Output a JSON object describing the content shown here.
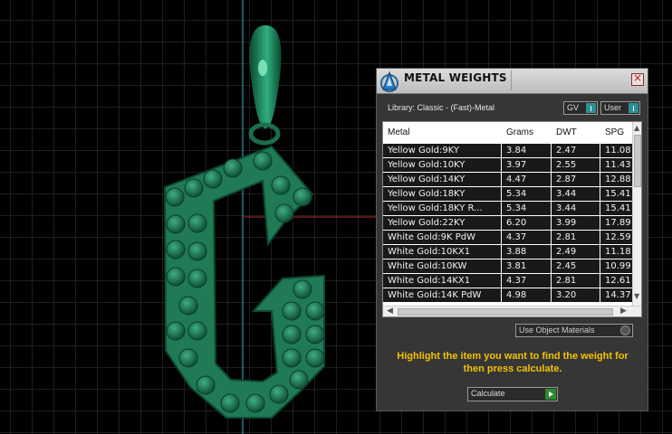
{
  "panel": {
    "title": "METAL WEIGHTS",
    "close_glyph": "×",
    "library_label": "Library: Classic - (Fast)-Metal",
    "toggles": {
      "gv": "GV",
      "user": "User"
    },
    "table": {
      "headers": [
        "Metal",
        "Grams",
        "DWT",
        "SPG"
      ],
      "rows": [
        [
          "Yellow Gold:9KY",
          "3.84",
          "2.47",
          "11.08"
        ],
        [
          "Yellow Gold:10KY",
          "3.97",
          "2.55",
          "11.43"
        ],
        [
          "Yellow Gold:14KY",
          "4.47",
          "2.87",
          "12.88"
        ],
        [
          "Yellow Gold:18KY",
          "5.34",
          "3.44",
          "15.41"
        ],
        [
          "Yellow Gold:18KY R...",
          "5.34",
          "3.44",
          "15.41"
        ],
        [
          "Yellow Gold:22KY",
          "6.20",
          "3.99",
          "17.89"
        ],
        [
          "White Gold:9K PdW",
          "4.37",
          "2.81",
          "12.59"
        ],
        [
          "White Gold:10KX1",
          "3.88",
          "2.49",
          "11.18"
        ],
        [
          "White Gold:10KW",
          "3.81",
          "2.45",
          "10.99"
        ],
        [
          "White Gold:14KX1",
          "4.37",
          "2.81",
          "12.61"
        ],
        [
          "White Gold:14K PdW",
          "4.98",
          "3.20",
          "14.37"
        ]
      ]
    },
    "use_object_materials": "Use Object Materials",
    "hint": "Highlight the item you want to find the weight for then press calculate.",
    "calculate_label": "Calculate"
  },
  "icons": {
    "app_logo": "matrix-logo-icon",
    "close": "close-icon",
    "scroll_up": "scroll-up-arrow-icon",
    "scroll_down": "scroll-down-arrow-icon",
    "scroll_left": "scroll-left-arrow-icon",
    "scroll_right": "scroll-right-arrow-icon",
    "calculate_go": "play-arrow-icon"
  },
  "colors": {
    "viewport_bg": "#000000",
    "grid": "#3a3a3a",
    "pendant_green": "#1f7a55",
    "accent_teal": "#2e8f97",
    "hint_yellow": "#f2c200"
  }
}
